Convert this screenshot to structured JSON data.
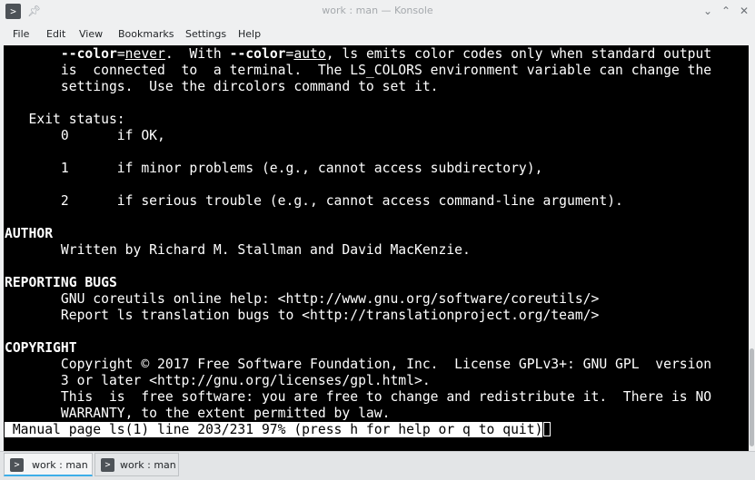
{
  "window": {
    "title": "work : man — Konsole",
    "app_icon": "terminal-icon",
    "pin_icon": "pin-icon",
    "controls": {
      "menu_glyph": "⌄",
      "minimize_glyph": "⌃",
      "close_glyph": "✕"
    }
  },
  "menu": [
    "File",
    "Edit",
    "View",
    "Bookmarks",
    "Settings",
    "Help"
  ],
  "terminal": {
    "l01": {
      "a": "       ",
      "b": "--color",
      "c": "=",
      "d": "never",
      "e": ".  With ",
      "f": "--color",
      "g": "=",
      "h": "auto",
      "i": ", ls emits color codes only when standard output"
    },
    "l02": "       is  connected  to  a terminal.  The LS_COLORS environment variable can change the",
    "l03": "       settings.  Use the dircolors command to set it.",
    "l04": "",
    "l05": "   Exit status:",
    "l06": "       0      if OK,",
    "l07": "",
    "l08": "       1      if minor problems (e.g., cannot access subdirectory),",
    "l09": "",
    "l10": "       2      if serious trouble (e.g., cannot access command-line argument).",
    "l11": "",
    "l12": "AUTHOR",
    "l13": "       Written by Richard M. Stallman and David MacKenzie.",
    "l14": "",
    "l15": "REPORTING BUGS",
    "l16": "       GNU coreutils online help: <http://www.gnu.org/software/coreutils/>",
    "l17": "       Report ls translation bugs to <http://translationproject.org/team/>",
    "l18": "",
    "l19": "COPYRIGHT",
    "l20": "       Copyright © 2017 Free Software Foundation, Inc.  License GPLv3+: GNU GPL  version",
    "l21": "       3 or later <http://gnu.org/licenses/gpl.html>.",
    "l22": "       This  is  free software: you are free to change and redistribute it.  There is NO",
    "l23": "       WARRANTY, to the extent permitted by law.",
    "status": " Manual page ls(1) line 203/231 97% (press h for help or q to quit)"
  },
  "tabs": [
    {
      "label": "work : man",
      "icon": "terminal-icon"
    },
    {
      "label": "work : man",
      "icon": "terminal-icon"
    }
  ]
}
